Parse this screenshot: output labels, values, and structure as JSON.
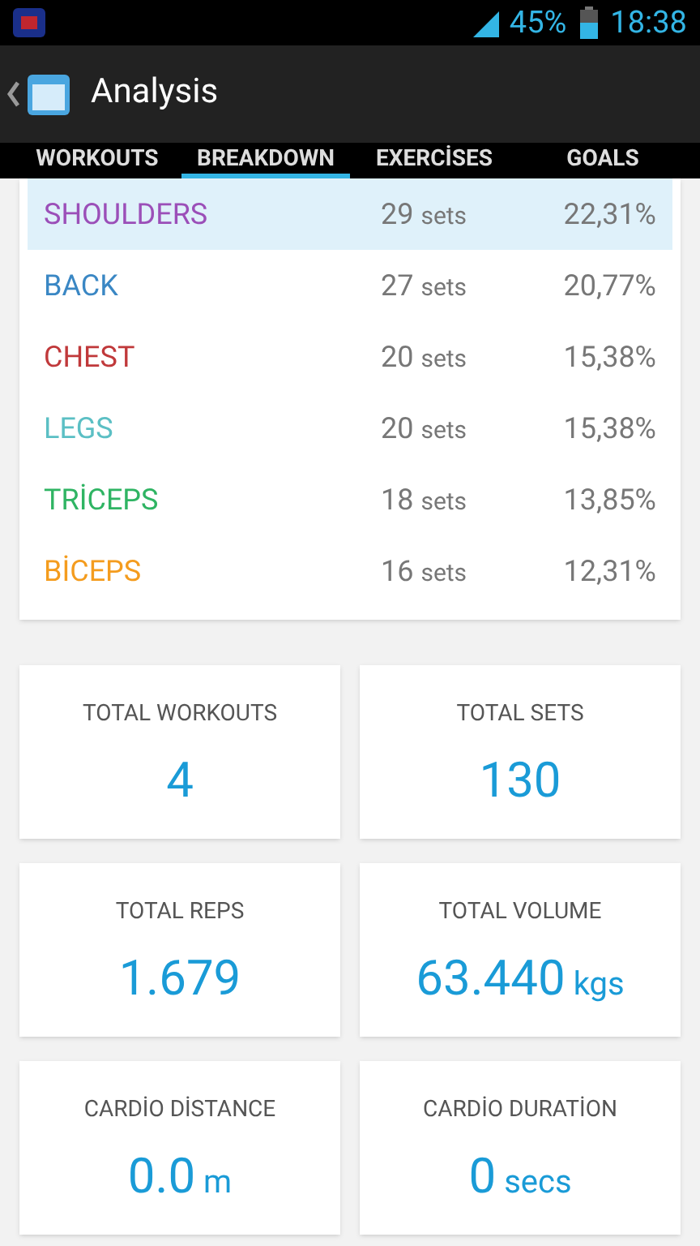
{
  "status_bar": {
    "battery_percent": "45%",
    "time": "18:38"
  },
  "action_bar": {
    "title": "Analysis"
  },
  "tabs": [
    {
      "label": "WORKOUTS",
      "selected": false
    },
    {
      "label": "BREAKDOWN",
      "selected": true
    },
    {
      "label": "EXERCİSES",
      "selected": false
    },
    {
      "label": "GOALS",
      "selected": false
    }
  ],
  "breakdown": [
    {
      "name": "SHOULDERS",
      "color": "#9b4fb8",
      "count": "29",
      "unit": "sets",
      "percent": "22,31%",
      "selected": true
    },
    {
      "name": "BACK",
      "color": "#3a87c4",
      "count": "27",
      "unit": "sets",
      "percent": "20,77%",
      "selected": false
    },
    {
      "name": "CHEST",
      "color": "#c0393b",
      "count": "20",
      "unit": "sets",
      "percent": "15,38%",
      "selected": false
    },
    {
      "name": "LEGS",
      "color": "#5bbfc4",
      "count": "20",
      "unit": "sets",
      "percent": "15,38%",
      "selected": false
    },
    {
      "name": "TRİCEPS",
      "color": "#2fb463",
      "count": "18",
      "unit": "sets",
      "percent": "13,85%",
      "selected": false
    },
    {
      "name": "BİCEPS",
      "color": "#f49c1e",
      "count": "16",
      "unit": "sets",
      "percent": "12,31%",
      "selected": false
    }
  ],
  "stats": [
    {
      "label": "TOTAL WORKOUTS",
      "value": "4"
    },
    {
      "label": "TOTAL SETS",
      "value": "130"
    },
    {
      "label": "TOTAL REPS",
      "value": "1.679"
    },
    {
      "label": "TOTAL VOLUME",
      "value": "63.440",
      "unit": "kgs"
    },
    {
      "label": "CARDİO DİSTANCE",
      "value": "0.0",
      "unit": "m"
    },
    {
      "label": "CARDİO DURATİON",
      "value": "0",
      "unit": "secs"
    }
  ]
}
